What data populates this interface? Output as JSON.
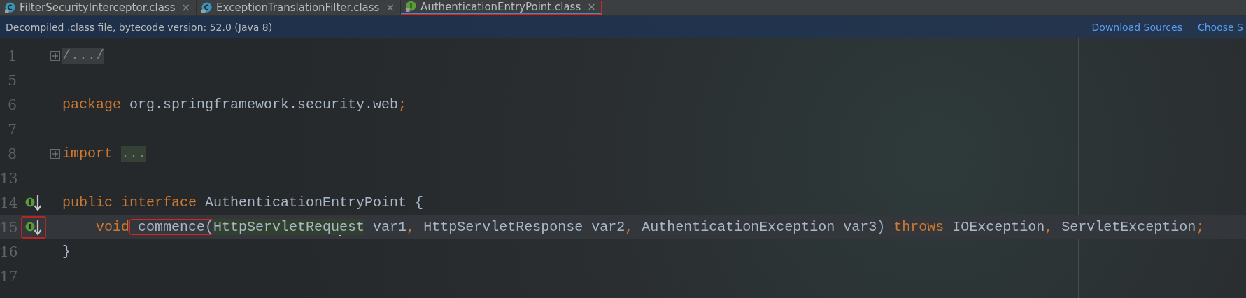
{
  "tabs": [
    {
      "label": "FilterSecurityInterceptor.class",
      "kind": "class",
      "selected": false,
      "boxed": false,
      "close": "×"
    },
    {
      "label": "ExceptionTranslationFilter.class",
      "kind": "class",
      "selected": false,
      "boxed": false,
      "close": "×"
    },
    {
      "label": "AuthenticationEntryPoint.class",
      "kind": "interface",
      "selected": true,
      "boxed": true,
      "close": "×"
    }
  ],
  "banner": {
    "message": "Decompiled .class file, bytecode version: 52.0 (Java 8)",
    "links": [
      "Download Sources",
      "Choose S"
    ]
  },
  "editor": {
    "lines": [
      {
        "number": "1",
        "fold": true,
        "current": false,
        "tokens": [
          {
            "text": "/.../",
            "kind": "folded"
          }
        ]
      },
      {
        "number": "5",
        "fold": false,
        "current": false
      },
      {
        "number": "6",
        "fold": false,
        "current": false,
        "tokens": [
          {
            "text": "package",
            "kind": "keyword"
          },
          {
            "text": " org.springframework.security.web",
            "kind": "plain"
          },
          {
            "text": ";",
            "kind": "punct"
          }
        ]
      },
      {
        "number": "7",
        "fold": false,
        "current": false
      },
      {
        "number": "8",
        "fold": true,
        "current": false,
        "tokens": [
          {
            "text": "import ",
            "kind": "keyword"
          },
          {
            "text": "...",
            "kind": "folded-import"
          }
        ]
      },
      {
        "number": "13",
        "fold": false,
        "current": false
      },
      {
        "number": "14",
        "fold": false,
        "gutter_marker": {
          "boxed": false
        },
        "current": false,
        "tokens": [
          {
            "text": "public interface",
            "kind": "keyword"
          },
          {
            "text": " AuthenticationEntryPoint {",
            "kind": "plain"
          }
        ]
      },
      {
        "number": "15",
        "fold": false,
        "gutter_marker": {
          "boxed": true
        },
        "current": true,
        "tokens": [
          {
            "text": "    void",
            "kind": "keyword"
          },
          {
            "text": " commence(",
            "kind": "plain",
            "boxed": true
          },
          {
            "text": "HttpServletRequ",
            "kind": "usage",
            "caret": true
          },
          {
            "text": "est",
            "kind": "usage"
          },
          {
            "text": " var1",
            "kind": "plain"
          },
          {
            "text": ",",
            "kind": "punct"
          },
          {
            "text": " HttpServletResponse var2",
            "kind": "plain"
          },
          {
            "text": ",",
            "kind": "punct"
          },
          {
            "text": " AuthenticationException var3) ",
            "kind": "plain"
          },
          {
            "text": "throws",
            "kind": "keyword"
          },
          {
            "text": " IOException",
            "kind": "plain"
          },
          {
            "text": ",",
            "kind": "punct"
          },
          {
            "text": " ServletException",
            "kind": "plain"
          },
          {
            "text": ";",
            "kind": "punct"
          }
        ]
      },
      {
        "number": "16",
        "fold": false,
        "current": false,
        "tokens": [
          {
            "text": "}",
            "kind": "plain"
          }
        ]
      },
      {
        "number": "17",
        "fold": false,
        "current": false
      }
    ]
  }
}
